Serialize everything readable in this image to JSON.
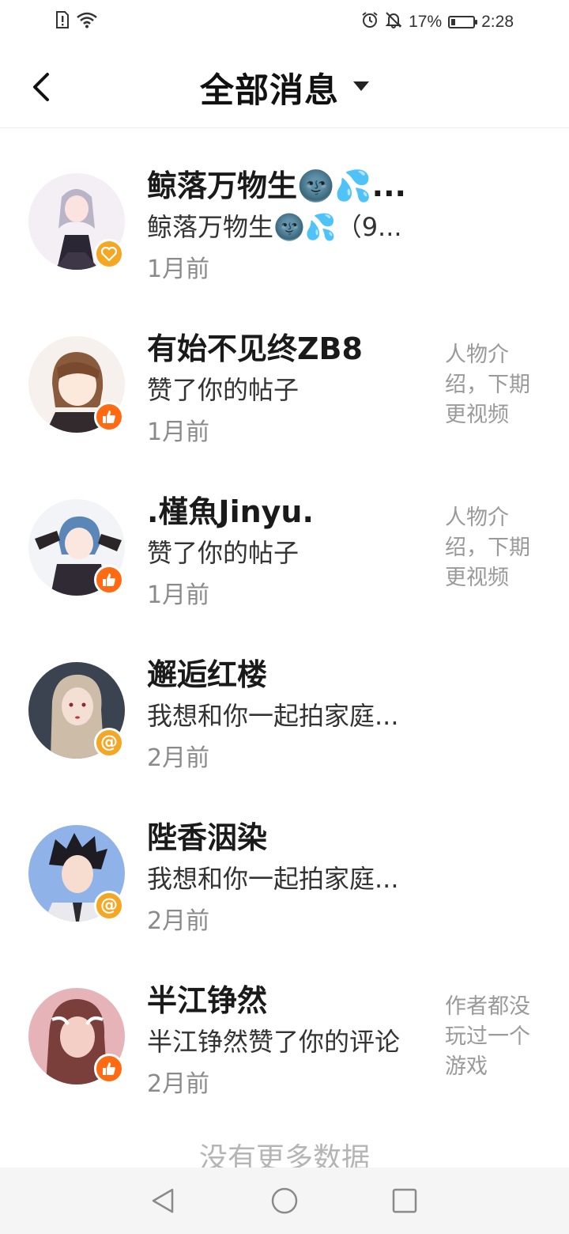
{
  "status_bar": {
    "battery": "17%",
    "time": "2:28"
  },
  "header": {
    "title": "全部消息"
  },
  "messages": [
    {
      "name": "鲸落万物生🌚💦...",
      "message": "鲸落万物生🌚💦（9...",
      "time": "1月前",
      "preview": "",
      "badge": "heart",
      "badge_color": "#f5a623"
    },
    {
      "name": "有始不见终ZB8",
      "message": "赞了你的帖子",
      "time": "1月前",
      "preview": "人物介绍，下期更视频",
      "badge": "thumbs-up",
      "badge_color": "#ff6a13"
    },
    {
      "name": ".槿魚Jinyu.",
      "message": "赞了你的帖子",
      "time": "1月前",
      "preview": "人物介绍，下期更视频",
      "badge": "thumbs-up",
      "badge_color": "#ff6a13"
    },
    {
      "name": "邂逅红楼",
      "message": "我想和你一起拍家庭...",
      "time": "2月前",
      "preview": "",
      "badge": "at",
      "badge_color": "#f5a623"
    },
    {
      "name": "陛香洇染",
      "message": "我想和你一起拍家庭...",
      "time": "2月前",
      "preview": "",
      "badge": "at",
      "badge_color": "#f5a623"
    },
    {
      "name": "半江铮然",
      "message": "半江铮然赞了你的评论",
      "time": "2月前",
      "preview": "作者都没玩过一个游戏",
      "badge": "thumbs-up",
      "badge_color": "#ff6a13"
    }
  ],
  "footer": {
    "no_more": "没有更多数据"
  }
}
